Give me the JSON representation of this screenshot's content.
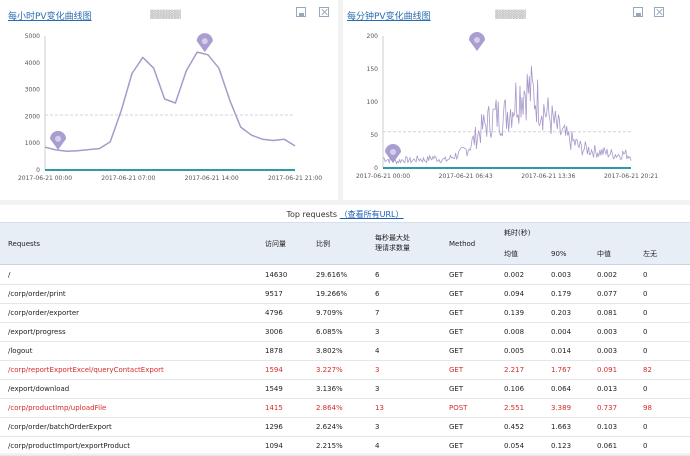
{
  "left_chart": {
    "title": "每小时PV变化曲线图",
    "subtitle": "▓▓▓▓▓",
    "chart_data": {
      "type": "line",
      "title": "每小时PV变化曲线图",
      "y_ticks": [
        "5000",
        "4000",
        "3000",
        "2000",
        "1000",
        "0"
      ],
      "x_ticks": [
        "2017-06-21 00:00",
        "2017-06-21 07:00",
        "2017-06-21 14:00",
        "2017-06-21 21:00"
      ],
      "ylim": [
        0,
        5000
      ],
      "x": [
        0,
        1,
        2,
        3,
        4,
        5,
        6,
        7,
        8,
        9,
        10,
        11,
        12,
        13,
        14,
        15,
        16,
        17,
        18,
        19,
        20,
        21,
        22,
        23
      ],
      "values": [
        850,
        750,
        700,
        720,
        760,
        800,
        1050,
        2200,
        3600,
        4200,
        3800,
        2650,
        2500,
        3700,
        4400,
        4300,
        3800,
        2600,
        1600,
        1300,
        1150,
        1100,
        1150,
        900
      ],
      "avg_line": 2050,
      "markers": [
        {
          "label": "min",
          "x": 1.2,
          "y": 750
        },
        {
          "label": "max",
          "x": 14.7,
          "y": 4400
        }
      ],
      "colors": {
        "line": "#a899c9",
        "marker": "#9b8cc8",
        "avg": "#cfd3dc",
        "axis": "#2e9aa8"
      }
    }
  },
  "right_chart": {
    "title": "每分钟PV变化曲线图",
    "subtitle": "▓▓▓▓▓",
    "chart_data": {
      "type": "line",
      "title": "每分钟PV变化曲线图",
      "y_ticks": [
        "200",
        "150",
        "100",
        "50",
        "0"
      ],
      "x_ticks": [
        "2017-06-21 00:00",
        "2017-06-21 06:43",
        "2017-06-21 13:36",
        "2017-06-21 20:21"
      ],
      "ylim": [
        0,
        200
      ],
      "shape": [
        15,
        12,
        10,
        13,
        11,
        14,
        12,
        16,
        13,
        12,
        18,
        22,
        30,
        45,
        60,
        72,
        80,
        78,
        90,
        110,
        120,
        115,
        100,
        85,
        70,
        55,
        45,
        38,
        30,
        28,
        25,
        24,
        22,
        20,
        22,
        18
      ],
      "colors": {
        "line": "#a899c9",
        "marker": "#9b8cc8",
        "avg": "#cfd3dc",
        "axis": "#2e9aa8"
      }
    }
  },
  "table": {
    "caption_prefix": "Top requests",
    "caption_link": "（查看所有URL）",
    "headers": {
      "requests": "Requests",
      "visits": "访问量",
      "ratio": "比例",
      "concurrency_l1": "每秒最大处",
      "concurrency_l2": "理请求数量",
      "method": "Method",
      "time": "耗时(秒)",
      "mean": "均值",
      "p90": "90%",
      "median": "中值",
      "none": "左无"
    },
    "rows": [
      {
        "request": "/",
        "visits": "14630",
        "ratio": "29.616%",
        "conc": "6",
        "method": "GET",
        "mean": "0.002",
        "p90": "0.003",
        "median": "0.002",
        "none": "0",
        "hl": false
      },
      {
        "request": "/corp/order/print",
        "visits": "9517",
        "ratio": "19.266%",
        "conc": "6",
        "method": "GET",
        "mean": "0.094",
        "p90": "0.179",
        "median": "0.077",
        "none": "0",
        "hl": false
      },
      {
        "request": "/corp/order/exporter",
        "visits": "4796",
        "ratio": "9.709%",
        "conc": "7",
        "method": "GET",
        "mean": "0.139",
        "p90": "0.203",
        "median": "0.081",
        "none": "0",
        "hl": false
      },
      {
        "request": "/export/progress",
        "visits": "3006",
        "ratio": "6.085%",
        "conc": "3",
        "method": "GET",
        "mean": "0.008",
        "p90": "0.004",
        "median": "0.003",
        "none": "0",
        "hl": false
      },
      {
        "request": "/logout",
        "visits": "1878",
        "ratio": "3.802%",
        "conc": "4",
        "method": "GET",
        "mean": "0.005",
        "p90": "0.014",
        "median": "0.003",
        "none": "0",
        "hl": false
      },
      {
        "request": "/corp/reportExportExcel/queryContactExport",
        "visits": "1594",
        "ratio": "3.227%",
        "conc": "3",
        "method": "GET",
        "mean": "2.217",
        "p90": "1.767",
        "median": "0.091",
        "none": "82",
        "hl": true
      },
      {
        "request": "/export/download",
        "visits": "1549",
        "ratio": "3.136%",
        "conc": "3",
        "method": "GET",
        "mean": "0.106",
        "p90": "0.064",
        "median": "0.013",
        "none": "0",
        "hl": false
      },
      {
        "request": "/corp/productImp/uploadFile",
        "visits": "1415",
        "ratio": "2.864%",
        "conc": "13",
        "method": "POST",
        "mean": "2.551",
        "p90": "3.389",
        "median": "0.737",
        "none": "98",
        "hl": true
      },
      {
        "request": "/corp/order/batchOrderExport",
        "visits": "1296",
        "ratio": "2.624%",
        "conc": "3",
        "method": "GET",
        "mean": "0.452",
        "p90": "1.663",
        "median": "0.103",
        "none": "0",
        "hl": false
      },
      {
        "request": "/corp/productImport/exportProduct",
        "visits": "1094",
        "ratio": "2.215%",
        "conc": "4",
        "method": "GET",
        "mean": "0.054",
        "p90": "0.123",
        "median": "0.061",
        "none": "0",
        "hl": false
      }
    ]
  }
}
